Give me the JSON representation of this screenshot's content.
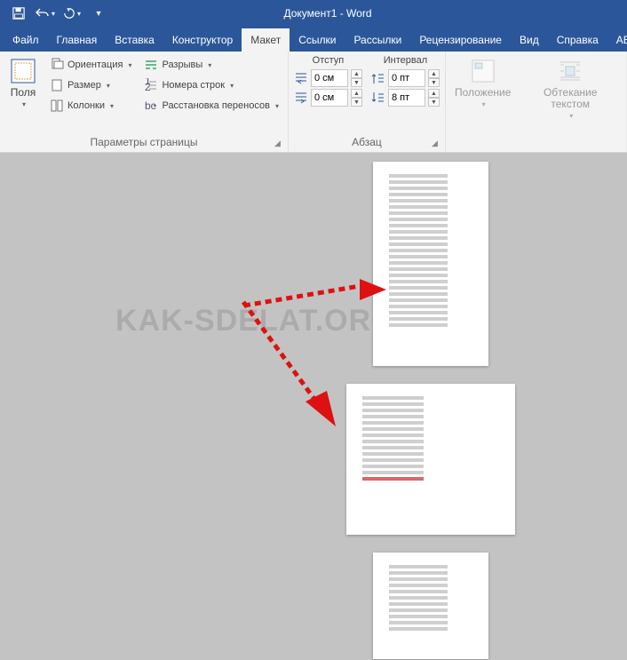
{
  "title": "Документ1 - Word",
  "tabs": {
    "file": "Файл",
    "home": "Главная",
    "insert": "Вставка",
    "design": "Конструктор",
    "layout": "Макет",
    "references": "Ссылки",
    "mailings": "Рассылки",
    "review": "Рецензирование",
    "view": "Вид",
    "help": "Справка",
    "abbyy": "ABB"
  },
  "pagesetup": {
    "margins": "Поля",
    "orientation": "Ориентация",
    "size": "Размер",
    "columns": "Колонки",
    "breaks": "Разрывы",
    "lineNumbers": "Номера строк",
    "hyphenation": "Расстановка переносов",
    "label": "Параметры страницы"
  },
  "paragraph": {
    "indentHead": "Отступ",
    "spacingHead": "Интервал",
    "leftIndent": "0 см",
    "rightIndent": "0 см",
    "before": "0 пт",
    "after": "8 пт",
    "label": "Абзац"
  },
  "arrange": {
    "position": "Положение",
    "wrap": "Обтекание текстом"
  },
  "watermark": "KAK-SDELAT.ORG"
}
